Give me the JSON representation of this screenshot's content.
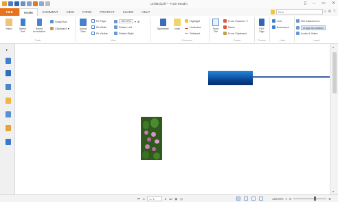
{
  "window": {
    "title": "Untitled.pdf * - Foxit Reader",
    "controls": [
      "▯",
      "─",
      "▭",
      "✕"
    ]
  },
  "tabs": [
    "FILE",
    "HOME",
    "COMMENT",
    "VIEW",
    "FORM",
    "PROTECT",
    "SHARE",
    "HELP"
  ],
  "search": {
    "placeholder": "Find"
  },
  "ribbon": {
    "hand": "Hand",
    "select_text": "Select Text",
    "select_annotation": "Select Annotation",
    "snapshot": "SnapShot",
    "clipboard": "Clipboard",
    "actual_size": "Actual Size",
    "fit_page": "Fit Page",
    "fit_width": "Fit Width",
    "fit_visible": "Fit Visible",
    "zoom_value": "120.00%",
    "rotate_left": "Rotate Left",
    "rotate_right": "Rotate Right",
    "typewriter": "Typewriter",
    "note": "Note",
    "highlight": "Highlight",
    "underline": "Underline",
    "strikeout": "Strikeout",
    "from_file": "From File",
    "from_scanner": "From Scanner",
    "blank": "Blank",
    "from_clipboard": "From Clipboard",
    "pdf_sign": "PDF Sign",
    "link": "Link",
    "bookmark": "Bookmark",
    "file_attachment": "File Attachment",
    "image_annotation": "Image Annotation",
    "audio_video": "Audio & Video",
    "group_tools": "Tools",
    "group_view": "View",
    "group_comment": "Comment",
    "group_create": "Create",
    "group_protect": "Protect",
    "group_links": "Links",
    "group_insert": "Insert"
  },
  "statusbar": {
    "page": "1 / 1",
    "zoom": "120.00%",
    "zoom_level": 0.62
  },
  "colors": {
    "file_tab": "#e8731d",
    "accent_blue": "#2b73c4"
  }
}
